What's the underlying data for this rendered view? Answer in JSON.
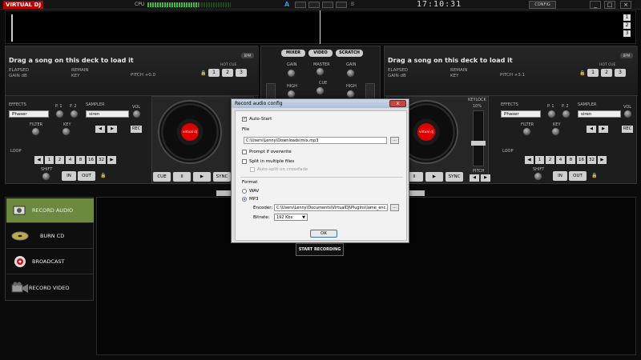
{
  "app": {
    "logo": "VIRTUAL DJ",
    "cpu_label": "CPU",
    "clock": "17:10:31",
    "config_label": "CONFIG",
    "window_buttons": [
      "_",
      "□",
      "×"
    ],
    "deck_indicator_a": "A",
    "deck_indicator_b": "B"
  },
  "waveform": {
    "zoom_buttons": [
      "1",
      "2",
      "3"
    ]
  },
  "deck_left": {
    "title": "Drag a song on this deck to load it",
    "elapsed": "ELAPSED",
    "gain": "GAIN dB",
    "remain": "REMAIN",
    "key": "KEY",
    "pitch": "PITCH +0.0",
    "bpm": "BPM",
    "hot_cue": "HOT CUE",
    "hot_cues": [
      "1",
      "2",
      "3"
    ],
    "effects_label": "EFFECTS",
    "effect_value": "Phaser",
    "p1": "P. 1",
    "p2": "P. 2",
    "sampler_label": "SAMPLER",
    "sampler_value": "siren",
    "vol": "VOL",
    "rec": "REC",
    "filter": "FILTER",
    "key_knob": "KEY",
    "loop_label": "LOOP",
    "loop_values": [
      "1",
      "2",
      "4",
      "8",
      "16",
      "32"
    ],
    "shift": "SHIFT",
    "in": "IN",
    "out": "OUT",
    "cue": "CUE",
    "pause": "II",
    "play": "▶",
    "sync": "SYNC",
    "platter_label": "virtual dj"
  },
  "deck_right": {
    "title": "Drag a song on this deck to load it",
    "elapsed": "ELAPSED",
    "gain": "GAIN dB",
    "remain": "REMAIN",
    "key": "KEY",
    "pitch": "PITCH +3.1",
    "bpm": "BPM",
    "hot_cue": "HOT CUE",
    "hot_cues": [
      "1",
      "2",
      "3"
    ],
    "keylock": "KEYLOCK",
    "keylock_pct": "10%",
    "pitch_label": "PITCH",
    "effects_label": "EFFECTS",
    "effect_value": "Phaser",
    "p1": "P. 1",
    "p2": "P. 2",
    "sampler_label": "SAMPLER",
    "sampler_value": "siren",
    "vol": "VOL",
    "rec": "REC",
    "filter": "FILTER",
    "key_knob": "KEY",
    "loop_label": "LOOP",
    "loop_values": [
      "1",
      "2",
      "4",
      "8",
      "16",
      "32"
    ],
    "shift": "SHIFT",
    "in": "IN",
    "out": "OUT",
    "pause": "II",
    "play": "▶",
    "sync": "SYNC",
    "platter_label": "virtual dj"
  },
  "mixer": {
    "tabs": [
      "MIXER",
      "VIDEO",
      "SCRATCH"
    ],
    "gain": "GAIN",
    "master": "MASTER",
    "high": "HIGH",
    "cue": "CUE"
  },
  "record_panel": {
    "items": [
      {
        "label": "RECORD AUDIO",
        "icon": "microphone-icon"
      },
      {
        "label": "BURN CD",
        "icon": "disc-icon"
      },
      {
        "label": "BROADCAST",
        "icon": "broadcast-icon"
      },
      {
        "label": "RECORD VIDEO",
        "icon": "video-camera-icon"
      }
    ],
    "start_recording": "START RECORDING"
  },
  "dialog": {
    "title": "Record audio config",
    "close": "x",
    "auto_start": "Auto-Start",
    "file_label": "File",
    "file_path": "C:\\Users\\Lenny\\Downloads\\mix.mp3",
    "browse": "...",
    "prompt_overwrite": "Prompt if overwrite",
    "split_multiple": "Split in multiple files",
    "auto_split": "Auto-split on crossfade",
    "format_label": "Format",
    "wav": "WAV",
    "mp3": "MP3",
    "encoder_label": "Encoder:",
    "encoder_path": "C:\\Users\\Lenny\\Documents\\VirtualDJ\\Plugins\\lame_enc.dll",
    "bitrate_label": "Bitrate:",
    "bitrate_value": "192 Kbs",
    "ok": "OK"
  }
}
